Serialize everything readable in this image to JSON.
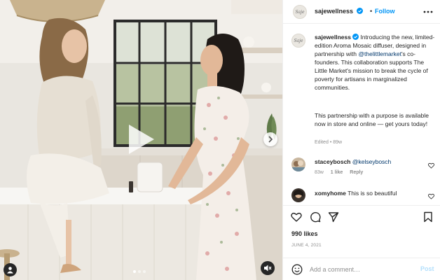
{
  "post": {
    "username": "sajewellness",
    "follow_label": "Follow",
    "separator": "•",
    "avatar_logo": "Saje",
    "caption_intro": "Introducing the new, limited-edition Aroma Mosaic diffuser, designed in partnership with",
    "caption_mention": "@thelittlemarket",
    "caption_rest": "'s co-founders. This collaboration supports The Little Market's mission to break the cycle of poverty for artisans in marginalized communities.",
    "caption_para2": "This partnership with a purpose is available now in store and online — get yours today!",
    "caption_edited": "Edited",
    "caption_age": "89w",
    "likes": "990 likes",
    "date": "JUNE 4, 2021"
  },
  "comments": [
    {
      "username": "staceybosch",
      "mention": "@kelseybosch",
      "text": "",
      "age": "83w",
      "likes": "1 like",
      "reply": "Reply"
    },
    {
      "username": "xomyhome",
      "mention": "",
      "text": "This is so beautiful",
      "age": "",
      "likes": "",
      "reply": ""
    }
  ],
  "composer": {
    "placeholder": "Add a comment…",
    "post_label": "Post"
  },
  "media": {
    "carousel_count": 3,
    "carousel_active": 1
  },
  "icons": {
    "verified": "verified-badge-icon",
    "more": "more-horizontal-icon",
    "play": "play-icon",
    "next": "chevron-right-icon",
    "tag": "user-tag-icon",
    "mute": "sound-off-icon",
    "like": "heart-icon",
    "comment": "comment-bubble-icon",
    "share": "paper-plane-icon",
    "save": "bookmark-icon",
    "emoji": "emoji-smile-icon"
  },
  "colors": {
    "accent": "#0095f6",
    "text": "#262626",
    "muted": "#8e8e8e",
    "mention": "#00376b",
    "post_disabled": "#b2dffc"
  }
}
